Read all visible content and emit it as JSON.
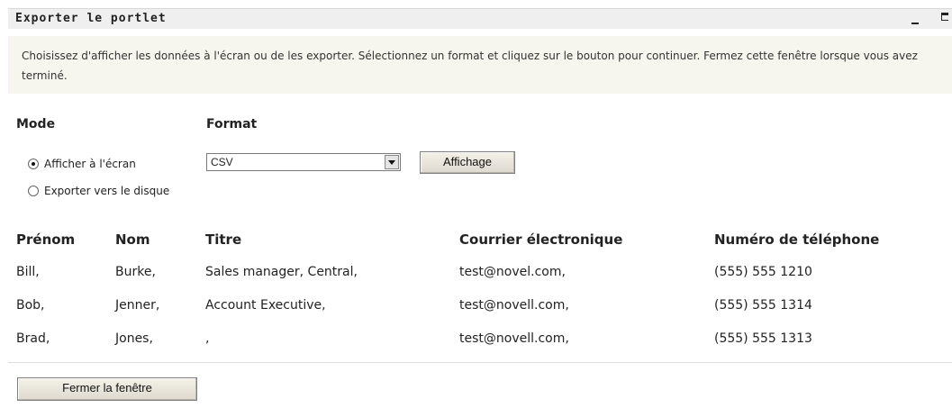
{
  "portlet": {
    "title": "Exporter le portlet",
    "description": "Choisissez d'afficher les données à l'écran ou de les exporter. Sélectionnez un format et cliquez sur le bouton pour continuer. Fermez cette fenêtre lorsque vous avez terminé."
  },
  "mode": {
    "label": "Mode",
    "options": [
      {
        "label": "Afficher à l'écran",
        "selected": true
      },
      {
        "label": "Exporter vers le disque",
        "selected": false
      }
    ]
  },
  "format": {
    "label": "Format",
    "selected": "CSV"
  },
  "buttons": {
    "display": "Affichage",
    "close": "Fermer la fenêtre"
  },
  "table": {
    "headers": [
      "Prénom",
      "Nom",
      "Titre",
      "Courrier électronique",
      "Numéro de téléphone"
    ],
    "rows": [
      [
        "Bill,",
        "Burke,",
        "Sales manager, Central,",
        "test@novel.com,",
        "(555) 555 1210"
      ],
      [
        "Bob,",
        "Jenner,",
        "Account Executive,",
        "test@novell.com,",
        "(555) 555 1314"
      ],
      [
        "Brad,",
        "Jones,",
        ",",
        "test@novell.com,",
        "(555) 555 1313"
      ]
    ]
  }
}
